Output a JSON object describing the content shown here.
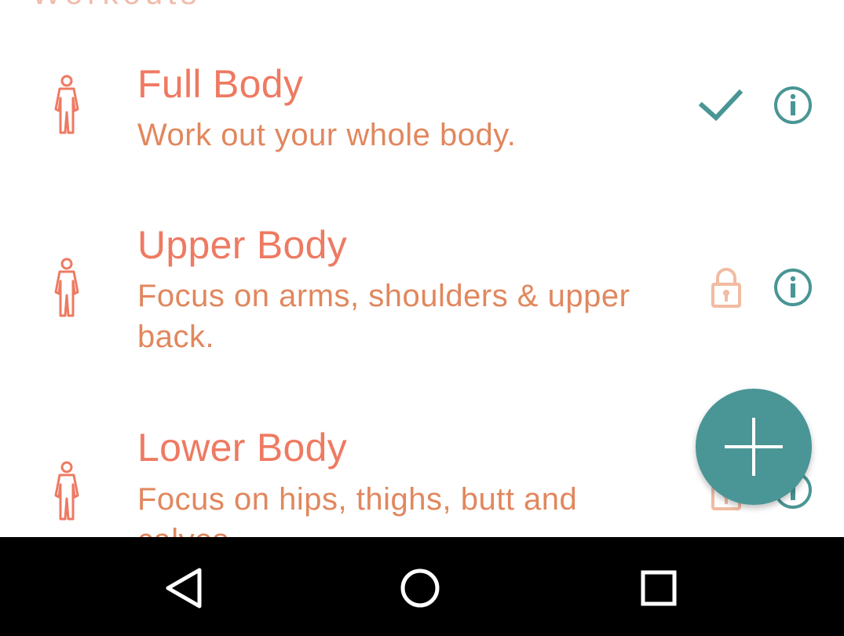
{
  "header": {
    "text": "Workouts"
  },
  "workouts": [
    {
      "title": "Full Body",
      "description": "Work out your whole body.",
      "status": "selected",
      "status_icon": "check-icon",
      "info_icon": "info-icon"
    },
    {
      "title": "Upper Body",
      "description": "Focus on arms, shoulders & upper back.",
      "status": "locked",
      "status_icon": "lock-icon",
      "info_icon": "info-icon"
    },
    {
      "title": "Lower Body",
      "description": "Focus on hips, thighs, butt and calves.",
      "status": "locked",
      "status_icon": "lock-icon",
      "info_icon": "info-icon"
    }
  ],
  "fab": {
    "icon": "plus-icon"
  },
  "navigation": {
    "back_icon": "back-triangle-icon",
    "home_icon": "home-circle-icon",
    "recents_icon": "recents-square-icon"
  },
  "colors": {
    "title": "#ee7a62",
    "description": "#e1875e",
    "accent": "#4a9595",
    "lock": "#f1bca3",
    "navbar": "#000000"
  }
}
